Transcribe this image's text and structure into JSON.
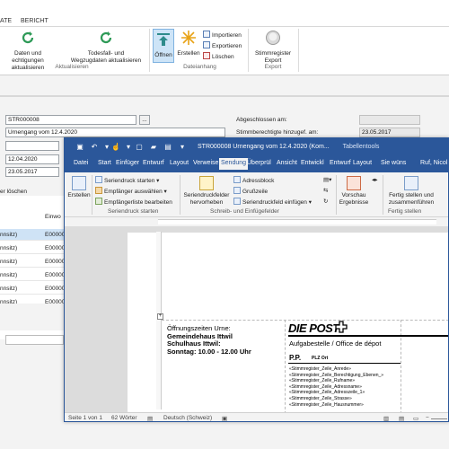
{
  "bg_app": {
    "tabs": [
      "ATE",
      "BERICHT"
    ],
    "ribbon": {
      "btn_daten": [
        "Daten und",
        "echtigungen aktualisieren"
      ],
      "btn_todesfall": [
        "Todesfall- und",
        "Wegzugdaten aktualisieren"
      ],
      "grp_aktualisieren": "Aktualisieren",
      "btn_oeffnen": "Öffnen",
      "btn_erstellen": "Erstellen",
      "btn_importieren": "Importieren",
      "btn_exportieren": "Exportieren",
      "btn_loeschen": "Löschen",
      "grp_dateianhang": "Dateianhang",
      "btn_stimmregister_export": [
        "Stimmregister",
        "Export"
      ],
      "grp_export": "Export"
    },
    "form": {
      "id_value": "STR000008",
      "ellipsis": "...",
      "description_value": "Urnengang vom 12.4.2020",
      "date1": "12.04.2020",
      "date2": "23.05.2017",
      "abgeschlossen_label": "Abgeschlossen am:",
      "stimmberechtigte_label": "Stimmberechtigte hinzugef. am:",
      "stimm_date": "23.05.2017",
      "right_date2": "23.05.2017",
      "loeschen_label": "er löschen",
      "col_header": "Einwo"
    },
    "grid_rows": [
      {
        "c1": "nnsitz)",
        "c2": "E00000",
        "selected": true
      },
      {
        "c1": "nnsitz)",
        "c2": "E00000",
        "selected": false
      },
      {
        "c1": "nnsitz)",
        "c2": "E00000",
        "selected": false
      },
      {
        "c1": "nnsitz)",
        "c2": "E00000",
        "selected": false
      },
      {
        "c1": "nnsitz)",
        "c2": "E00000",
        "selected": false
      },
      {
        "c1": "nnsitz)",
        "c2": "E00000",
        "selected": false
      }
    ]
  },
  "word": {
    "title": "STR000008 Urnengang vom 12.4.2020 (Kom...",
    "context_tab": "Tabellentools",
    "tabs": [
      "Datei",
      "Start",
      "Einfüger",
      "Entwurf",
      "Layout",
      "Verweise",
      "Sendung",
      "Überprül",
      "Ansicht",
      "Entwickl",
      "Entwurf",
      "Layout",
      "Sie wüns",
      "Ruf, Nicol"
    ],
    "active_tab_index": 6,
    "ribbon": {
      "erstellen": "Erstellen",
      "serien_starten": "Seriendruck starten",
      "empfaenger_auswaehlen": "Empfänger auswählen",
      "empfaengerliste": "Empfängerliste bearbeiten",
      "grp_serien": "Seriendruck starten",
      "seriendruckfelder": [
        "Seriendruckfelder",
        "hervorheben"
      ],
      "adressblock": "Adressblock",
      "grussleile": "Grußzeile",
      "seriendruckfeld_einfuegen": "Seriendruckfeld einfügen",
      "grp_schreib": "Schreib- und Einfügefelder",
      "vorschau": [
        "Vorschau",
        "Ergebnisse"
      ],
      "fertig": [
        "Fertig stellen und",
        "zusammenführen"
      ],
      "grp_fertig": "Fertig stellen"
    },
    "doc": {
      "oeffnungszeiten": "Öffnungszeiten Urne:",
      "gemeindehaus": "Gemeindehaus Ittwil",
      "schulhaus": "Schulhaus Ittwil:",
      "sonntag": "Sonntag: 10.00 - 12.00 Uhr",
      "die_post": "DIE POST",
      "aufgabestelle": "Aufgabestelle / Office de dépot",
      "pp": "P.P.",
      "plz": "PLZ Ort",
      "merge_fields": [
        "«Stimmregister_Zeile_Anrede»",
        "«Stimmregister_Zeile_Berechtigung_Ebenen_»",
        "«Stimmregister_Zeile_Rufname»",
        "«Stimmregister_Zeile_Adressname»",
        "«Stimmregister_Zeile_Adresszeile_1»",
        "«Stimmregister_Zeile_Strasse»",
        "«Stimmregister_Zeile_Hausnummer»"
      ]
    },
    "status": {
      "page": "Seite 1 von 1",
      "words": "62 Wörter",
      "language": "Deutsch (Schweiz)"
    }
  },
  "colors": {
    "word_blue": "#2b579a",
    "selection_blue": "#cfe3f6",
    "refresh_green": "#2e9a57"
  }
}
